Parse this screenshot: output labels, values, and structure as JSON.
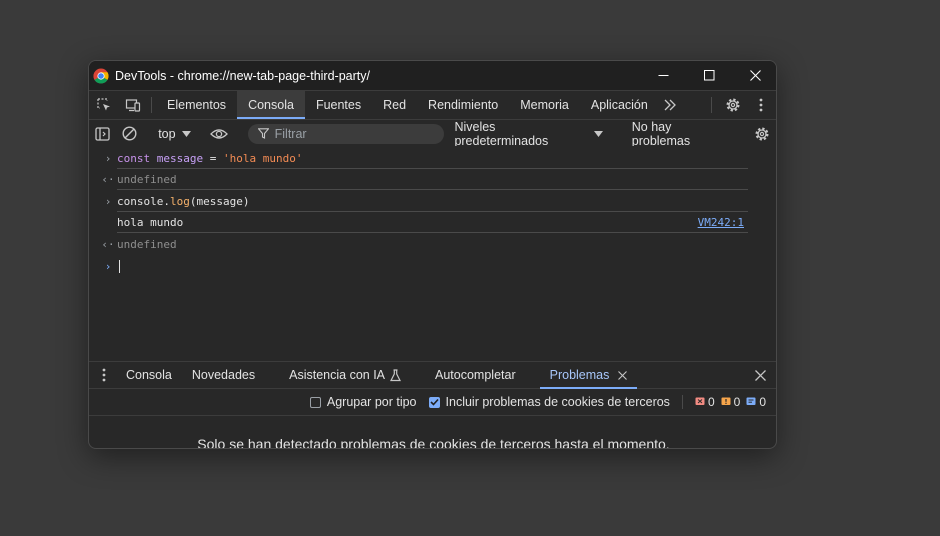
{
  "window": {
    "title": "DevTools - chrome://new-tab-page-third-party/"
  },
  "tabs": [
    "Elementos",
    "Consola",
    "Fuentes",
    "Red",
    "Rendimiento",
    "Memoria",
    "Aplicación"
  ],
  "toolbar": {
    "context": "top",
    "filter_placeholder": "Filtrar",
    "levels": "Niveles predeterminados",
    "issues": "No hay problemas"
  },
  "console": {
    "line1": {
      "keyword": "const",
      "name": "message",
      "op": " = ",
      "value": "'hola mundo'"
    },
    "line2": "undefined",
    "line3": {
      "obj": "console.",
      "fn": "log",
      "args": "(message)"
    },
    "line4": {
      "text": "hola mundo",
      "source": "VM242:1"
    },
    "line5": "undefined"
  },
  "drawer": {
    "tabs": [
      "Consola",
      "Novedades",
      "Asistencia con IA",
      "Autocompletar",
      "Problemas"
    ],
    "group_label": "Agrupar por tipo",
    "include_label": "Incluir problemas de cookies de terceros",
    "counts": {
      "errors": "0",
      "warnings": "0",
      "info": "0"
    },
    "message": "Solo se han detectado problemas de cookies de terceros hasta el momento."
  },
  "colors": {
    "accent": "#7cacf8",
    "error": "#f28b82",
    "warning": "#f6a54b",
    "info": "#7cacf8"
  }
}
